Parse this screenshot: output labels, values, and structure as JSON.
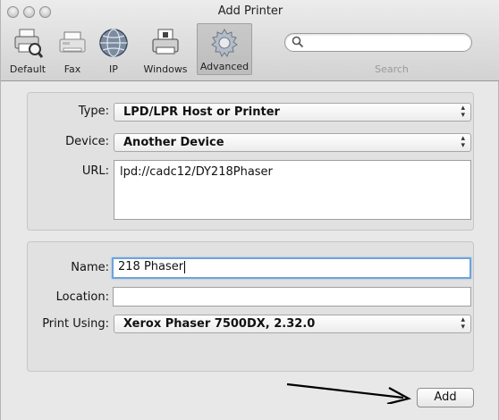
{
  "window": {
    "title": "Add Printer"
  },
  "toolbar": {
    "tabs": [
      {
        "label": "Default",
        "icon": "printer-search-icon"
      },
      {
        "label": "Fax",
        "icon": "fax-icon"
      },
      {
        "label": "IP",
        "icon": "globe-icon"
      },
      {
        "label": "Windows",
        "icon": "windows-printer-icon"
      },
      {
        "label": "Advanced",
        "icon": "gear-icon",
        "selected": true
      }
    ],
    "search": {
      "placeholder": "",
      "label": "Search"
    }
  },
  "connection": {
    "type_label": "Type:",
    "type_value": "LPD/LPR Host or Printer",
    "device_label": "Device:",
    "device_value": "Another Device",
    "url_label": "URL:",
    "url_value": "lpd://cadc12/DY218Phaser"
  },
  "details": {
    "name_label": "Name:",
    "name_value": "218 Phaser",
    "location_label": "Location:",
    "location_value": "",
    "print_using_label": "Print Using:",
    "print_using_value": "Xerox Phaser 7500DX, 2.32.0"
  },
  "footer": {
    "add_label": "Add"
  },
  "colors": {
    "focus_ring": "#6ea3da",
    "window_bg": "#e8e8e8",
    "group_bg": "#e1e1e1"
  }
}
